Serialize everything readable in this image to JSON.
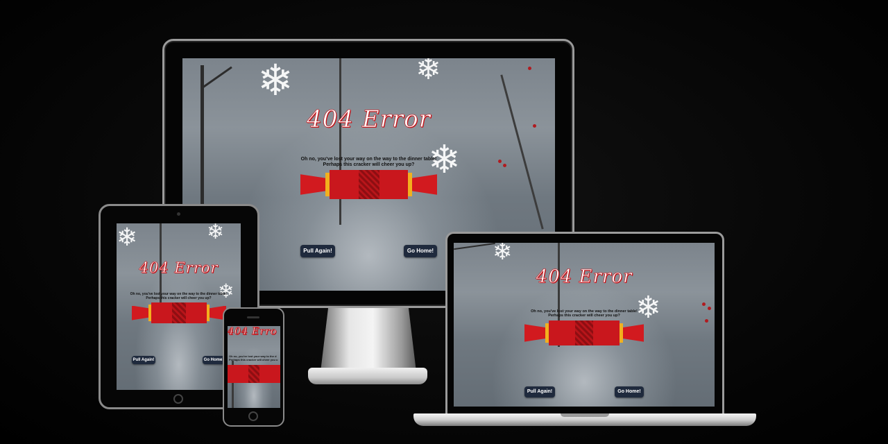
{
  "page": {
    "title": "404 Error",
    "message_line1": "Oh no, you've lost your way on the way to the dinner table!",
    "message_line2": "Perhaps this cracker will cheer you up?",
    "pull_button": "Pull Again!",
    "home_button": "Go Home!",
    "phone_title": "404 Erro",
    "phone_message_line1": "Oh no, you've lost your way to the d",
    "phone_message_line2": "Perhaps this cracker will cheer you u"
  },
  "icons": {
    "snowflake": "snowflake-icon",
    "tree": "bare-tree-illustration",
    "cracker": "christmas-cracker-illustration"
  },
  "colors": {
    "title_red": "#c2151b",
    "cracker_red": "#c9171d",
    "cracker_band": "#f2b01e",
    "button_bg": "#1f2a3d",
    "backdrop": "#050505"
  }
}
